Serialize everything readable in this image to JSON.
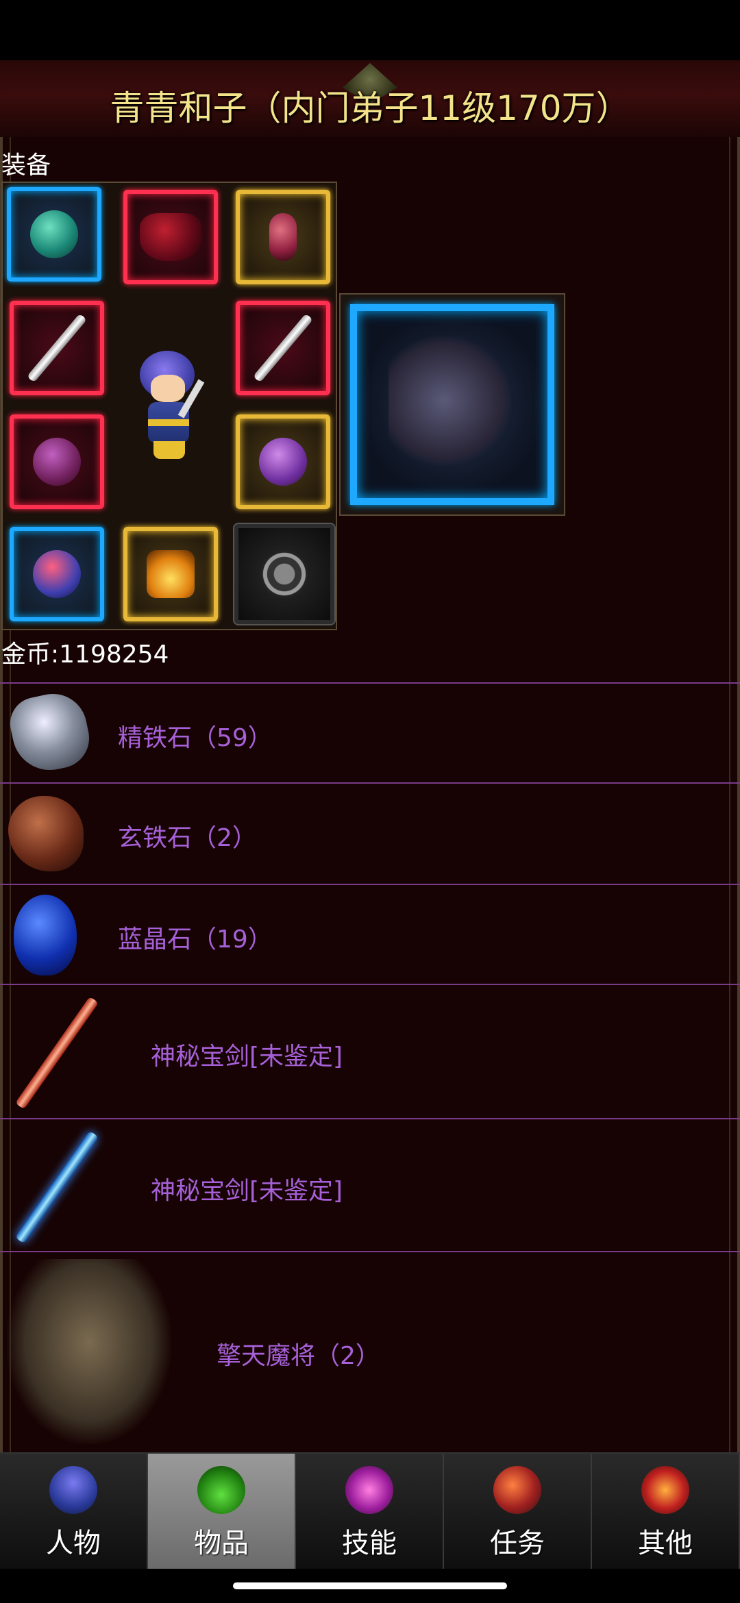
{
  "header": {
    "title": "青青和子（内门弟子11级170万）"
  },
  "equipment": {
    "label": "装备",
    "slots": [
      "helm-icon",
      "cloth-icon",
      "necklace-icon",
      "weapon-left-icon",
      "weapon-right-icon",
      "armor-icon",
      "ring-icon",
      "boots-icon",
      "fire-charm-icon",
      "prayer-beads-icon"
    ],
    "mount": "mount-icon"
  },
  "gold": {
    "text": "金币:1198254"
  },
  "inventory": [
    {
      "name": "精铁石（59）",
      "icon": "iron-ore-icon"
    },
    {
      "name": "玄铁石（2）",
      "icon": "dark-iron-ore-icon"
    },
    {
      "name": "蓝晶石（19）",
      "icon": "blue-crystal-icon"
    },
    {
      "name": "神秘宝剑[未鉴定]",
      "icon": "red-sword-icon"
    },
    {
      "name": "神秘宝剑[未鉴定]",
      "icon": "blue-sword-icon"
    },
    {
      "name": "擎天魔将（2）",
      "icon": "demon-general-icon"
    }
  ],
  "tabs": [
    {
      "label": "人物",
      "icon": "character-icon",
      "active": false
    },
    {
      "label": "物品",
      "icon": "potion-icon",
      "active": true
    },
    {
      "label": "技能",
      "icon": "skill-icon",
      "active": false
    },
    {
      "label": "任务",
      "icon": "quest-icon",
      "active": false
    },
    {
      "label": "其他",
      "icon": "other-icon",
      "active": false
    }
  ],
  "colors": {
    "title": "#f4e38a",
    "item_text": "#a660d8",
    "divider": "#7a3a8a",
    "panel_bg": "#170303"
  }
}
